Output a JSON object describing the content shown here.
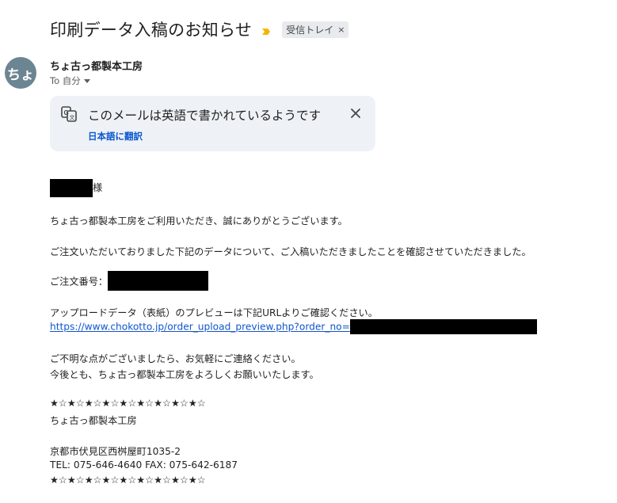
{
  "email": {
    "subject": "印刷データ入稿のお知らせ",
    "label": "受信トレイ",
    "label_close": "×",
    "avatar_text": "ちょ",
    "sender": "ちょ古っ都製本工房",
    "to_line": "To 自分"
  },
  "translate_banner": {
    "title": "このメールは英語で書かれているようです",
    "link": "日本語に翻訳"
  },
  "body": {
    "salutation": "様",
    "line1": "ちょ古っ都製本工房をご利用いただき、誠にありがとうございます。",
    "line2": "ご注文いただいておりました下記のデータについて、ご入稿いただきましたことを確認させていただきました。",
    "order_label": "ご注文番号：",
    "preview_text": "アップロードデータ（表紙）のプレビューは下記URLよりご確認ください。",
    "preview_url": "https://www.chokotto.jp/order_upload_preview.php?order_no=",
    "contact1": "ご不明な点がございましたら、お気軽にご連絡ください。",
    "contact2": "今後とも、ちょ古っ都製本工房をよろしくお願いいたします。",
    "stars": "★☆★☆★☆★☆★☆★☆★☆★☆★☆",
    "sig_name": "ちょ古っ都製本工房",
    "sig_address": "京都市伏見区西桝屋町1035-2",
    "sig_phone": "TEL: 075-646-4640  FAX: 075-642-6187",
    "stars_end": "★☆★☆★☆★☆★☆★☆★☆★☆★☆"
  },
  "colors": {
    "avatar_bg": "#6c8592",
    "banner_bg": "#eef2f6",
    "link": "#1155cc",
    "importance": "#f2b600"
  },
  "icons": [
    "importance-marker-icon",
    "translate-icon",
    "close-icon",
    "chevron-down-icon"
  ]
}
